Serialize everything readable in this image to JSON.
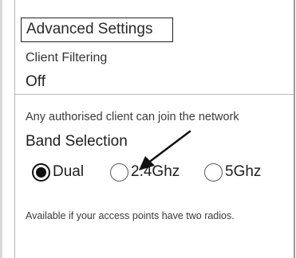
{
  "advanced_settings": {
    "label": "Advanced Settings"
  },
  "client_filtering": {
    "label": "Client Filtering",
    "value": "Off",
    "description": "Any authorised client can join the network"
  },
  "band_selection": {
    "title": "Band Selection",
    "options": [
      {
        "label": "Dual",
        "selected": true
      },
      {
        "label": "2.4Ghz",
        "selected": false
      },
      {
        "label": "5Ghz",
        "selected": false
      }
    ],
    "note": "Available if your access points have two radios."
  },
  "annotation": {
    "icon": "arrow-icon",
    "color": "#111111"
  }
}
